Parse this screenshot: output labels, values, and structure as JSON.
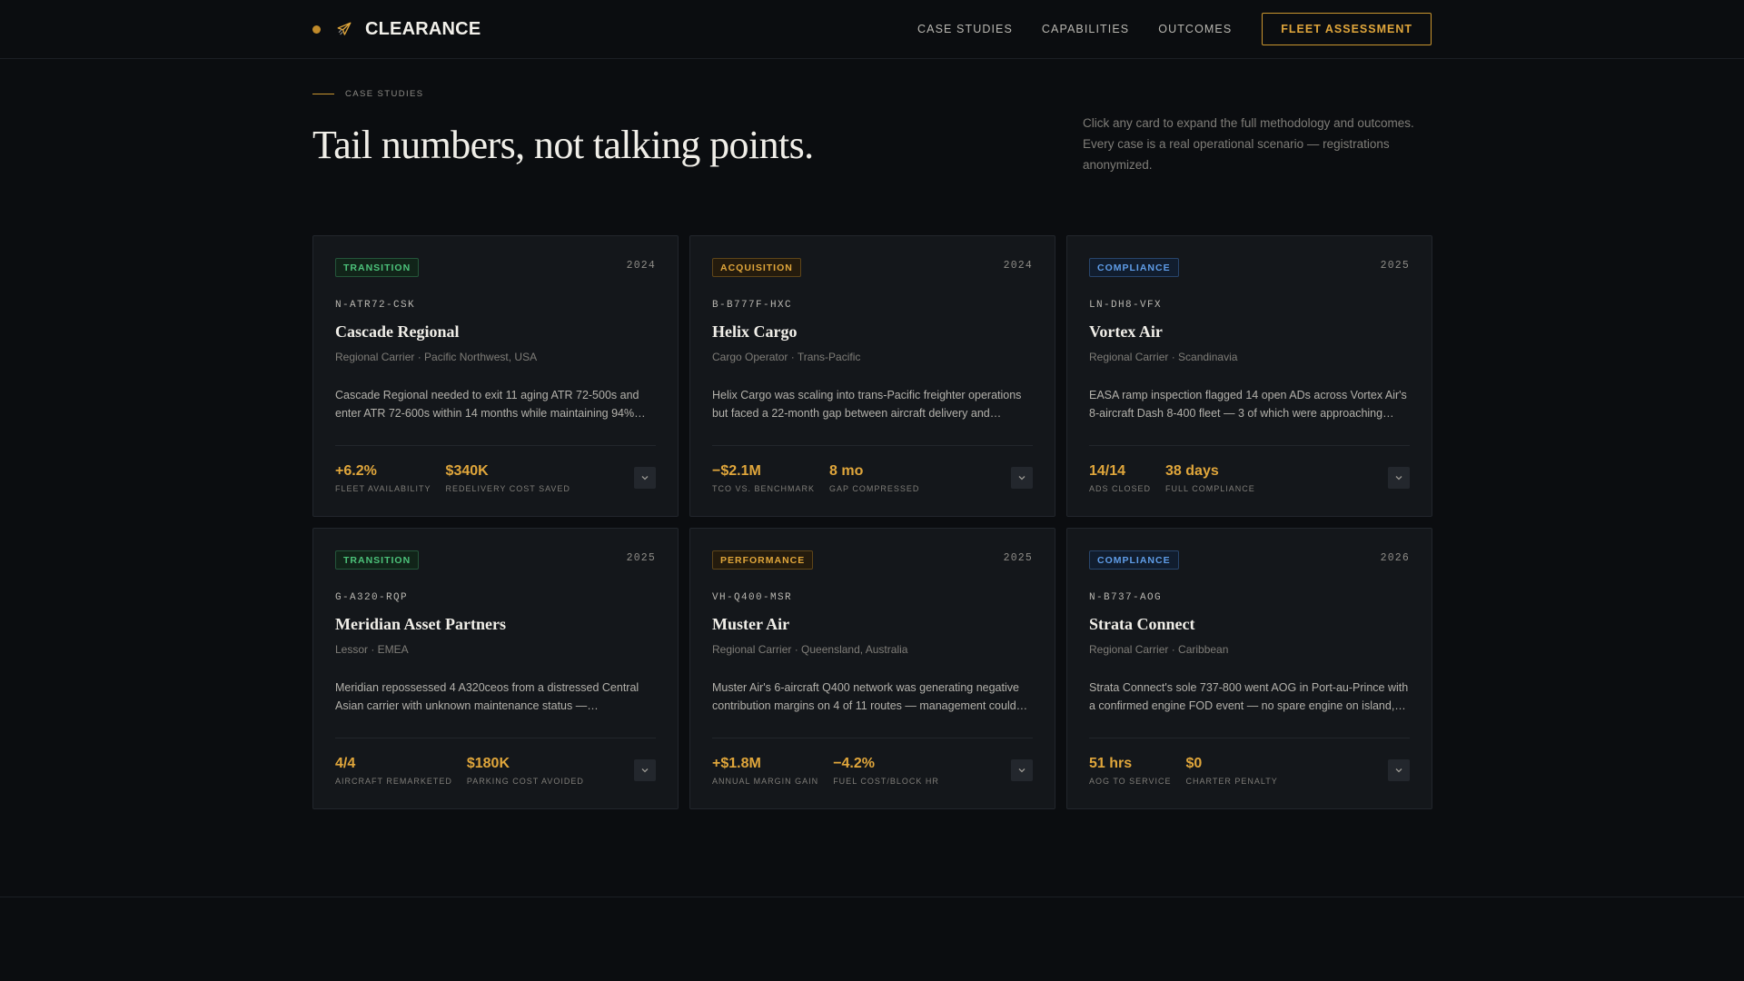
{
  "header": {
    "brand_name": "CLEARANCE",
    "brand_icon": "plane-icon",
    "nav": [
      "CASE STUDIES",
      "CAPABILITIES",
      "OUTCOMES"
    ],
    "cta_label": "FLEET ASSESSMENT"
  },
  "hero": {
    "eyebrow": "CASE STUDIES",
    "title": "Tail numbers, not talking points.",
    "description": "Click any card to expand the full methodology and outcomes. Every case is a real operational scenario — registrations anonymized."
  },
  "colors": {
    "background": "#0b0d10",
    "card": "#14171b",
    "accent": "#e0a63b",
    "transition": "#4cc27a",
    "compliance": "#5f9de8"
  },
  "cards": [
    {
      "tag": "TRANSITION",
      "tag_type": "transition",
      "year": "2024",
      "registration": "N-ATR72-CSK",
      "title": "Cascade Regional",
      "meta": "Regional Carrier · Pacific Northwest, USA",
      "description": "Cascade Regional needed to exit 11 aging ATR 72-500s and enter ATR 72-600s within 14 months while maintaining 94%…",
      "metrics": [
        {
          "value": "+6.2%",
          "label": "FLEET AVAILABILITY"
        },
        {
          "value": "$340K",
          "label": "REDELIVERY COST SAVED"
        }
      ]
    },
    {
      "tag": "ACQUISITION",
      "tag_type": "acquisition",
      "year": "2024",
      "registration": "B-B777F-HXC",
      "title": "Helix Cargo",
      "meta": "Cargo Operator · Trans-Pacific",
      "description": "Helix Cargo was scaling into trans-Pacific freighter operations but faced a 22-month gap between aircraft delivery and…",
      "metrics": [
        {
          "value": "−$2.1M",
          "label": "TCO VS. BENCHMARK"
        },
        {
          "value": "8 mo",
          "label": "GAP COMPRESSED"
        }
      ]
    },
    {
      "tag": "COMPLIANCE",
      "tag_type": "compliance",
      "year": "2025",
      "registration": "LN-DH8-VFX",
      "title": "Vortex Air",
      "meta": "Regional Carrier · Scandinavia",
      "description": "EASA ramp inspection flagged 14 open ADs across Vortex Air's 8-aircraft Dash 8-400 fleet — 3 of which were approaching…",
      "metrics": [
        {
          "value": "14/14",
          "label": "ADS CLOSED"
        },
        {
          "value": "38 days",
          "label": "FULL COMPLIANCE"
        }
      ]
    },
    {
      "tag": "TRANSITION",
      "tag_type": "transition",
      "year": "2025",
      "registration": "G-A320-RQP",
      "title": "Meridian Asset Partners",
      "meta": "Lessor · EMEA",
      "description": "Meridian repossessed 4 A320ceos from a distressed Central Asian carrier with unknown maintenance status —…",
      "metrics": [
        {
          "value": "4/4",
          "label": "AIRCRAFT REMARKETED"
        },
        {
          "value": "$180K",
          "label": "PARKING COST AVOIDED"
        }
      ]
    },
    {
      "tag": "PERFORMANCE",
      "tag_type": "performance",
      "year": "2025",
      "registration": "VH-Q400-MSR",
      "title": "Muster Air",
      "meta": "Regional Carrier · Queensland, Australia",
      "description": "Muster Air's 6-aircraft Q400 network was generating negative contribution margins on 4 of 11 routes — management could…",
      "metrics": [
        {
          "value": "+$1.8M",
          "label": "ANNUAL MARGIN GAIN"
        },
        {
          "value": "−4.2%",
          "label": "FUEL COST/BLOCK HR"
        }
      ]
    },
    {
      "tag": "COMPLIANCE",
      "tag_type": "compliance",
      "year": "2026",
      "registration": "N-B737-AOG",
      "title": "Strata Connect",
      "meta": "Regional Carrier · Caribbean",
      "description": "Strata Connect's sole 737-800 went AOG in Port-au-Prince with a confirmed engine FOD event — no spare engine on island,…",
      "metrics": [
        {
          "value": "51 hrs",
          "label": "AOG TO SERVICE"
        },
        {
          "value": "$0",
          "label": "CHARTER PENALTY"
        }
      ]
    }
  ]
}
